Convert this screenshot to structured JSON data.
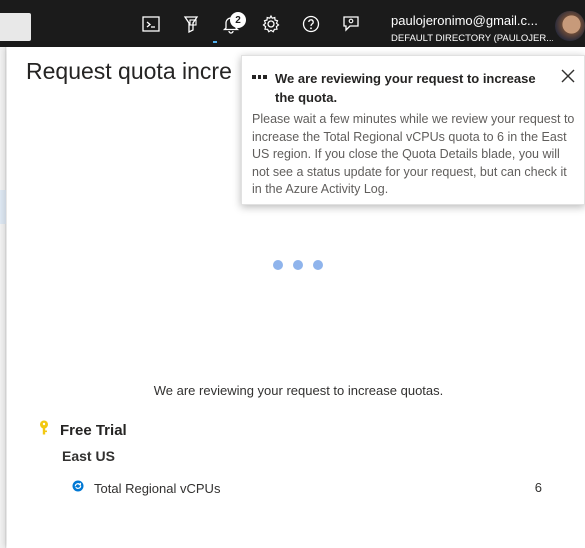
{
  "topbar": {
    "notification_count": "2",
    "account": {
      "email": "paulojeronimo@gmail.c...",
      "directory": "DEFAULT DIRECTORY (PAULOJER..."
    },
    "icons": [
      "cloud-shell-icon",
      "directory-filter-icon",
      "notifications-icon",
      "settings-icon",
      "help-icon",
      "feedback-icon"
    ]
  },
  "blade": {
    "title": "Request quota incre",
    "status_message": "We are reviewing your request to increase quotas.",
    "subscription": "Free Trial",
    "region": "East US",
    "quota": {
      "name": "Total Regional vCPUs",
      "value": "6"
    }
  },
  "notification": {
    "title": "We are reviewing your request to increase the quota.",
    "body": "Please wait a few minutes while we review your request to increase the Total Regional vCPUs quota to 6 in the East US region. If you close the Quota Details blade, you will not see a status update for your request, but can check it in the Azure Activity Log."
  },
  "colors": {
    "topbar_bg": "#1b1b1b",
    "loading_dot": "#8fb4ec",
    "key_icon": "#f2c811",
    "refresh_icon": "#0078d4"
  }
}
